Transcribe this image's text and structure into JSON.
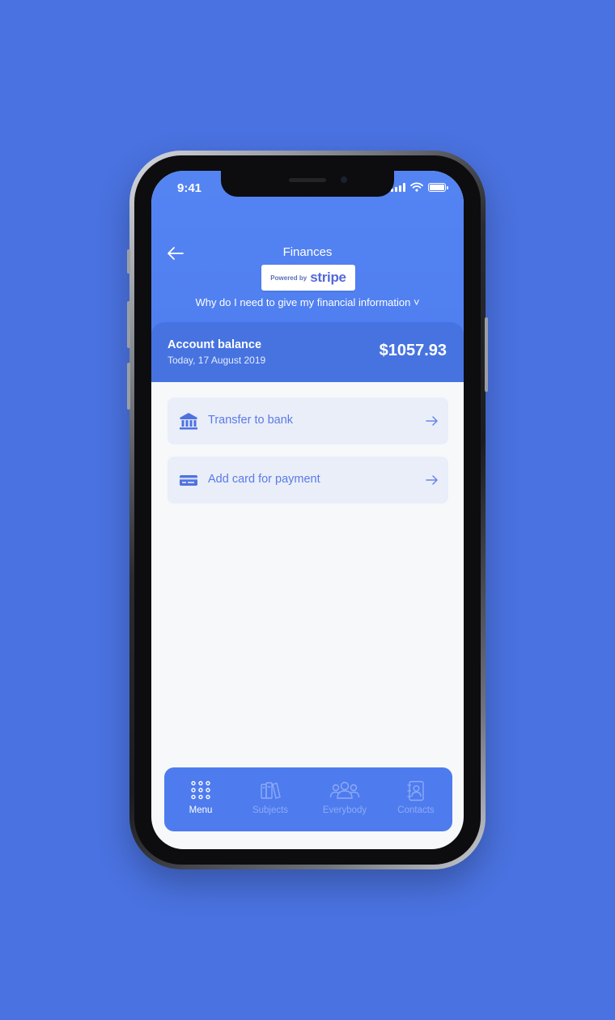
{
  "colors": {
    "background": "#4a72e0",
    "header": "#5484f2",
    "balance_card": "#4673df",
    "action_card": "#e9eef9",
    "action_text": "#5b7ae4",
    "tabbar": "#4e7bee"
  },
  "status_bar": {
    "time": "9:41"
  },
  "header": {
    "title": "Finances",
    "badge": {
      "powered_by": "Powered by",
      "brand": "stripe"
    },
    "info_link": "Why do I need to give my financial information ˅"
  },
  "balance": {
    "label": "Account balance",
    "date": "Today, 17 August 2019",
    "amount": "$1057.93"
  },
  "actions": [
    {
      "label": "Transfer to bank",
      "icon": "bank-icon"
    },
    {
      "label": "Add card for payment",
      "icon": "credit-card-icon"
    }
  ],
  "tabs": [
    {
      "label": "Menu",
      "icon": "grid-dots-icon",
      "active": true
    },
    {
      "label": "Subjects",
      "icon": "books-icon",
      "active": false
    },
    {
      "label": "Everybody",
      "icon": "group-icon",
      "active": false
    },
    {
      "label": "Contacts",
      "icon": "address-book-icon",
      "active": false
    }
  ]
}
